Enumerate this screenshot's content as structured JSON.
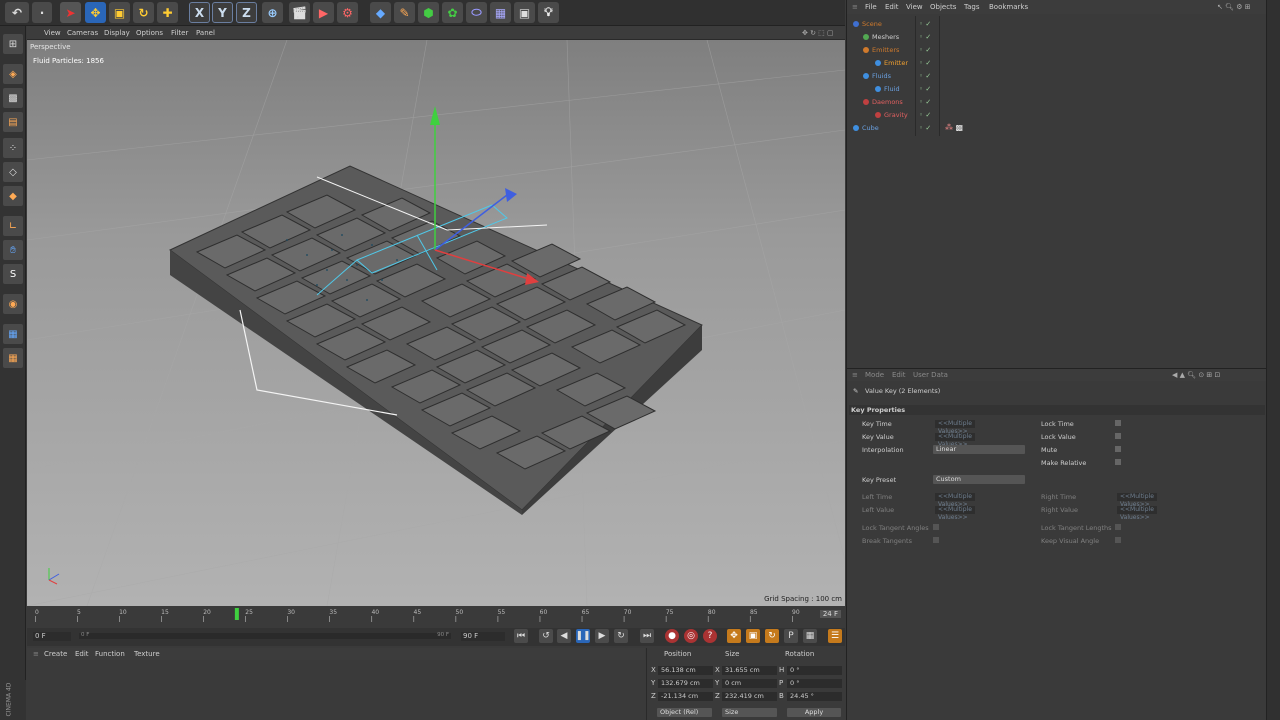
{
  "viewport": {
    "menu": [
      "View",
      "Cameras",
      "Display",
      "Options",
      "Filter",
      "Panel"
    ],
    "camera_label": "Perspective",
    "info": "Fluid Particles: 1856",
    "grid_spacing": "Grid Spacing : 100 cm"
  },
  "timeline": {
    "ticks": [
      "0",
      "5",
      "10",
      "15",
      "20",
      "25",
      "30",
      "35",
      "40",
      "45",
      "50",
      "55",
      "60",
      "65",
      "70",
      "75",
      "80",
      "85",
      "90"
    ],
    "current_frame": 24,
    "frame_badge": "24 F",
    "min_frame": "0 F",
    "max_frame": "90 F",
    "range_start": "0 F",
    "range_end": "90 F"
  },
  "materials": {
    "menu": [
      "Create",
      "Edit",
      "Function",
      "Texture"
    ],
    "brand": "CINEMA 4D"
  },
  "coordinates": {
    "headers": [
      "Position",
      "Size",
      "Rotation"
    ],
    "rows": [
      {
        "axis": "X",
        "pos": "56.138 cm",
        "size_axis": "X",
        "size": "31.655 cm",
        "rot_axis": "H",
        "rot": "0 °"
      },
      {
        "axis": "Y",
        "pos": "132.679 cm",
        "size_axis": "Y",
        "size": "0 cm",
        "rot_axis": "P",
        "rot": "0 °"
      },
      {
        "axis": "Z",
        "pos": "-21.134 cm",
        "size_axis": "Z",
        "size": "232.419 cm",
        "rot_axis": "B",
        "rot": "24.45 °"
      }
    ],
    "mode": "Object (Rel)",
    "size_mode": "Size",
    "apply": "Apply"
  },
  "object_manager": {
    "menu": [
      "File",
      "Edit",
      "View",
      "Objects",
      "Tags",
      "Bookmarks"
    ],
    "tree": [
      {
        "name": "Scene",
        "indent": 0,
        "color": "#3f6fd0"
      },
      {
        "name": "Meshers",
        "indent": 1,
        "color": "#52a852"
      },
      {
        "name": "Emitters",
        "indent": 1,
        "color": "#d07a2c"
      },
      {
        "name": "Emitter",
        "indent": 2,
        "color": "#3f8fe0"
      },
      {
        "name": "Fluids",
        "indent": 1,
        "color": "#3f8fe0"
      },
      {
        "name": "Fluid",
        "indent": 2,
        "color": "#3f8fe0"
      },
      {
        "name": "Daemons",
        "indent": 1,
        "color": "#c04040"
      },
      {
        "name": "Gravity",
        "indent": 2,
        "color": "#c04040"
      },
      {
        "name": "Cube",
        "indent": 0,
        "color": "#3f8fe0"
      }
    ]
  },
  "attributes": {
    "menu": [
      "Mode",
      "Edit",
      "User Data"
    ],
    "title": "Value Key (2 Elements)",
    "section": "Key Properties",
    "key_time_label": "Key Time",
    "key_value_label": "Key Value",
    "interpolation_label": "Interpolation",
    "interpolation_value": "Linear",
    "multiple_placeholder": "<<Multiple Values>>",
    "lock_time": "Lock Time",
    "lock_value": "Lock Value",
    "mute": "Mute",
    "make_relative": "Make Relative",
    "key_preset_label": "Key Preset",
    "key_preset_value": "Custom",
    "left_time": "Left Time",
    "left_value": "Left Value",
    "right_time": "Right Time",
    "right_value": "Right Value",
    "lock_tangent_angles": "Lock Tangent Angles",
    "break_tangents": "Break Tangents",
    "lock_tangent_lengths": "Lock Tangent Lengths",
    "keep_visual_angle": "Keep Visual Angle"
  },
  "toolbar": {
    "axis_x": "X",
    "axis_y": "Y",
    "axis_z": "Z"
  }
}
